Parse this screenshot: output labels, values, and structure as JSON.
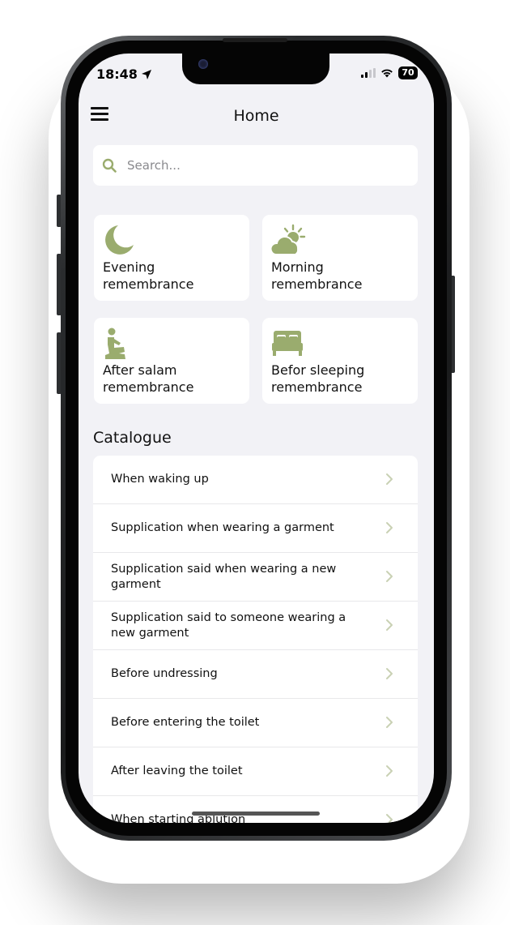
{
  "status": {
    "time": "18:48",
    "battery": "70"
  },
  "header": {
    "title": "Home"
  },
  "search": {
    "placeholder": "Search..."
  },
  "cards": [
    {
      "label": "Evening remembrance",
      "icon": "moon-icon"
    },
    {
      "label": "Morning remembrance",
      "icon": "sun-cloud-icon"
    },
    {
      "label": "After salam remembrance",
      "icon": "praying-person-icon"
    },
    {
      "label": "Befor sleeping remembrance",
      "icon": "bed-icon"
    }
  ],
  "catalogue": {
    "title": "Catalogue",
    "items": [
      "When waking up",
      "Supplication when wearing a garment",
      "Supplication said when wearing a new garment",
      "Supplication said to someone wearing a new garment",
      "Before undressing",
      "Before entering the toilet",
      "After leaving the toilet",
      "When starting ablution"
    ]
  },
  "colors": {
    "accent": "#9aac6e",
    "background": "#f2f2f6",
    "card": "#ffffff",
    "chevron": "#c9d1b4"
  }
}
